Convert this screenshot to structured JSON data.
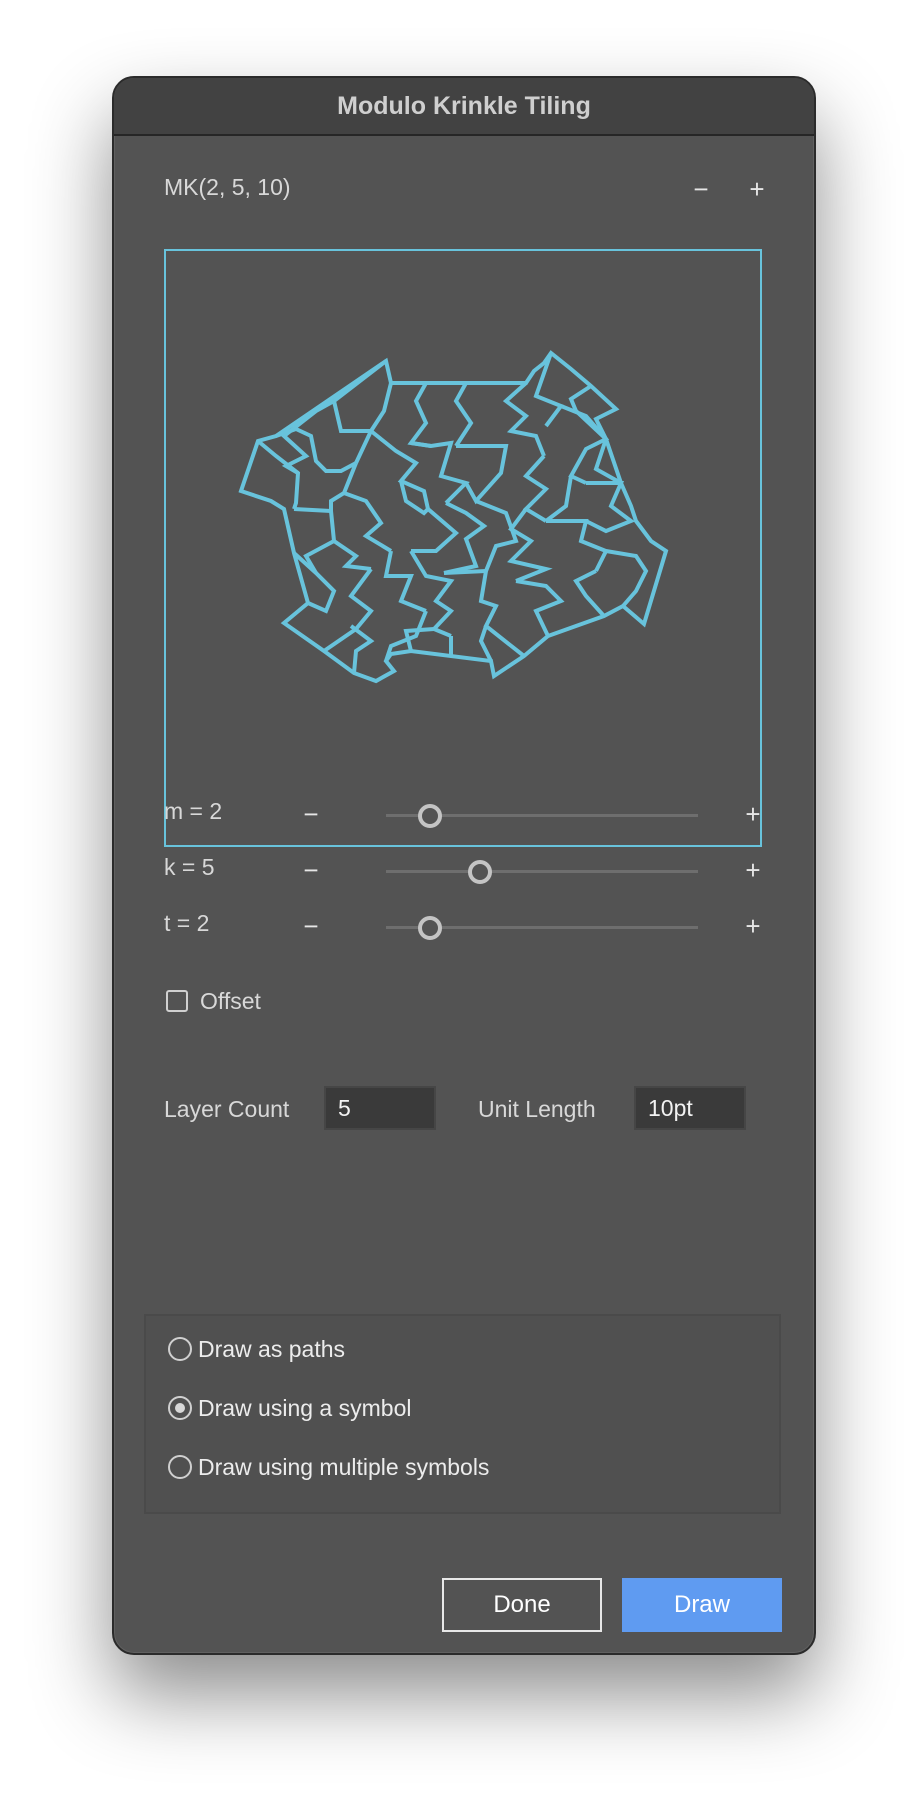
{
  "window": {
    "title": "Modulo Krinkle Tiling"
  },
  "header": {
    "tiling_label": "MK(2, 5, 10)",
    "minus": "−",
    "plus": "+"
  },
  "params": [
    {
      "label": "m = 2",
      "minus": "−",
      "plus": "+",
      "value": 2,
      "min": 1,
      "max": 10
    },
    {
      "label": "k = 5",
      "minus": "−",
      "plus": "+",
      "value": 5,
      "min": 3,
      "max": 10
    },
    {
      "label": "t = 2",
      "minus": "−",
      "plus": "+",
      "value": 2,
      "min": 1,
      "max": 10
    }
  ],
  "offset": {
    "label": "Offset",
    "checked": false
  },
  "fields": {
    "layer_count_label": "Layer Count",
    "layer_count_value": "5",
    "unit_length_label": "Unit Length",
    "unit_length_value": "10pt"
  },
  "draw_mode": {
    "options": [
      {
        "label": "Draw as paths",
        "checked": false
      },
      {
        "label": "Draw using a symbol",
        "checked": true
      },
      {
        "label": "Draw using multiple symbols",
        "checked": false
      }
    ]
  },
  "buttons": {
    "done": "Done",
    "draw": "Draw"
  },
  "colors": {
    "tile_stroke": "#68c3dc",
    "accent": "#5f9bf1",
    "panel": "#535353"
  }
}
